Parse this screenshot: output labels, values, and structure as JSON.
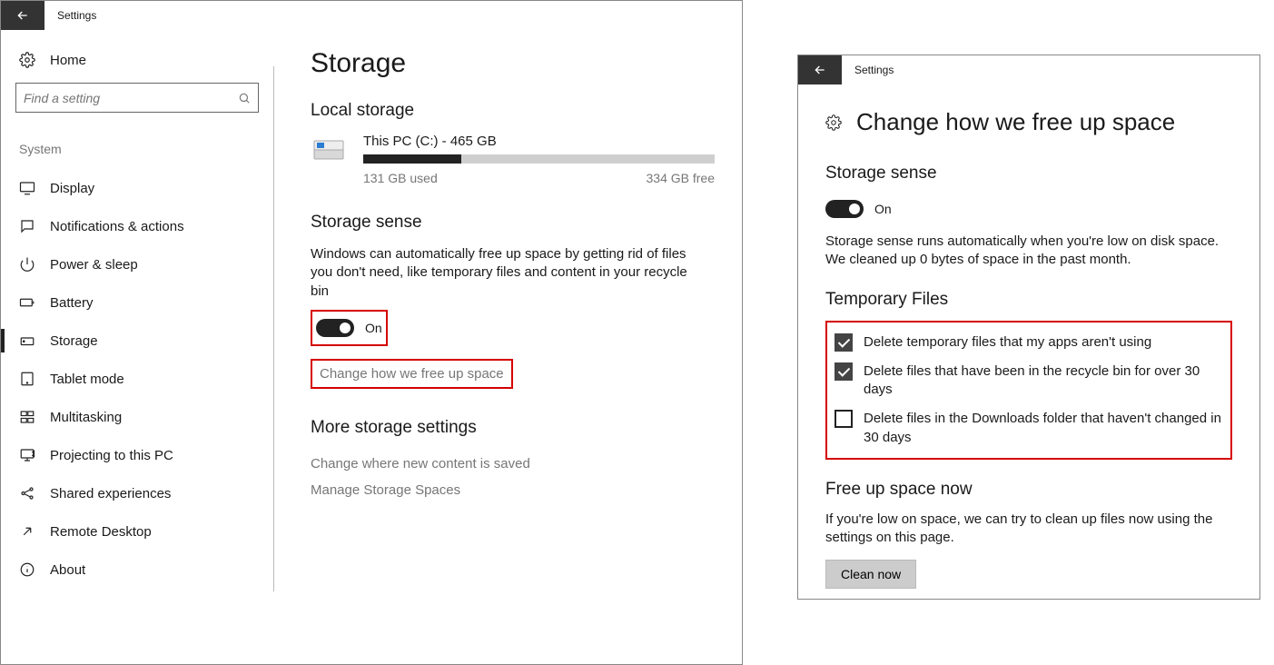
{
  "left": {
    "title": "Settings",
    "home_label": "Home",
    "search_placeholder": "Find a setting",
    "group_label": "System",
    "nav": [
      {
        "label": "Display",
        "selected": false
      },
      {
        "label": "Notifications & actions",
        "selected": false
      },
      {
        "label": "Power & sleep",
        "selected": false
      },
      {
        "label": "Battery",
        "selected": false
      },
      {
        "label": "Storage",
        "selected": true
      },
      {
        "label": "Tablet mode",
        "selected": false
      },
      {
        "label": "Multitasking",
        "selected": false
      },
      {
        "label": "Projecting to this PC",
        "selected": false
      },
      {
        "label": "Shared experiences",
        "selected": false
      },
      {
        "label": "Remote Desktop",
        "selected": false
      },
      {
        "label": "About",
        "selected": false
      }
    ],
    "page_title": "Storage",
    "local_storage_heading": "Local storage",
    "drive": {
      "name": "This PC (C:) - 465 GB",
      "used_label": "131 GB used",
      "free_label": "334 GB free",
      "used_pct": 28
    },
    "storage_sense_heading": "Storage sense",
    "storage_sense_desc": "Windows can automatically free up space by getting rid of files you don't need, like temporary files and content in your recycle bin",
    "toggle_label": "On",
    "change_link": "Change how we free up space",
    "more_heading": "More storage settings",
    "more_links": {
      "change_save_loc": "Change where new content is saved",
      "manage_spaces": "Manage Storage Spaces"
    }
  },
  "right": {
    "title": "Settings",
    "page_title": "Change how we free up space",
    "storage_sense_heading": "Storage sense",
    "toggle_label": "On",
    "sense_desc": "Storage sense runs automatically when you're low on disk space. We cleaned up 0 bytes of space in the past month.",
    "temp_heading": "Temporary Files",
    "checks": [
      {
        "label": "Delete temporary files that my apps aren't using",
        "checked": true
      },
      {
        "label": "Delete files that have been in the recycle bin for over 30 days",
        "checked": true
      },
      {
        "label": "Delete files in the Downloads folder that haven't changed in 30 days",
        "checked": false
      }
    ],
    "free_now_heading": "Free up space now",
    "free_now_desc": "If you're low on space, we can try to clean up files now using the settings on this page.",
    "clean_btn": "Clean now"
  }
}
